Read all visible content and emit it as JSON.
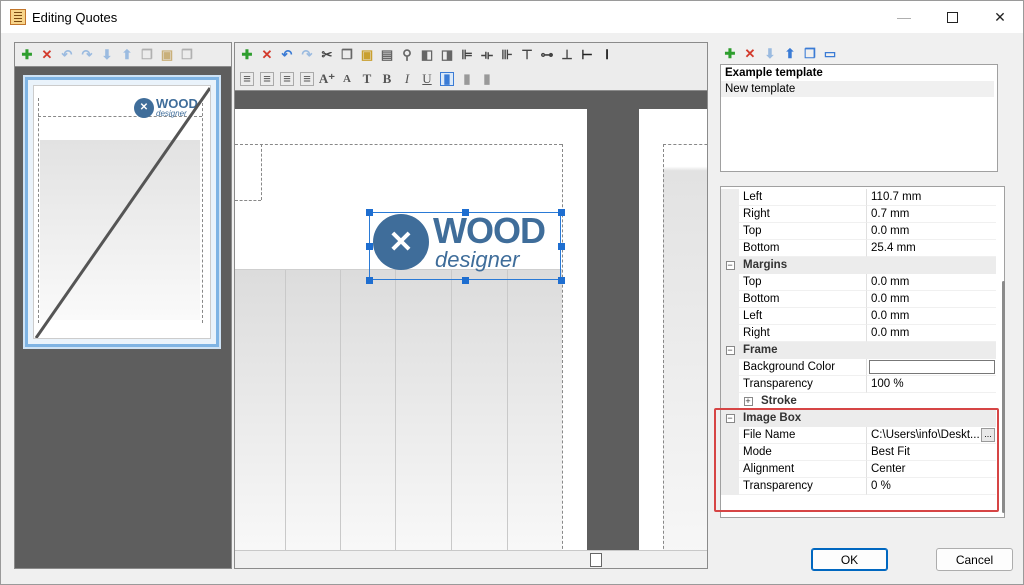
{
  "window": {
    "title": "Editing Quotes",
    "controls": {
      "minimize": "—",
      "close": "✕"
    }
  },
  "logo": {
    "word": "WOOD",
    "sub": "designer",
    "color": "#3f6d9a"
  },
  "templates": {
    "items": [
      {
        "label": "Example template",
        "selected": true
      },
      {
        "label": "New template",
        "selected": false
      }
    ]
  },
  "properties": {
    "rows": [
      {
        "type": "prop",
        "name": "Left",
        "value": "110.7 mm"
      },
      {
        "type": "prop",
        "name": "Right",
        "value": "0.7 mm"
      },
      {
        "type": "prop",
        "name": "Top",
        "value": "0.0 mm"
      },
      {
        "type": "prop",
        "name": "Bottom",
        "value": "25.4 mm"
      },
      {
        "type": "category",
        "name": "Margins",
        "toggle": "−"
      },
      {
        "type": "prop",
        "name": "Top",
        "value": "0.0 mm"
      },
      {
        "type": "prop",
        "name": "Bottom",
        "value": "0.0 mm"
      },
      {
        "type": "prop",
        "name": "Left",
        "value": "0.0 mm"
      },
      {
        "type": "prop",
        "name": "Right",
        "value": "0.0 mm"
      },
      {
        "type": "category",
        "name": "Frame",
        "toggle": "−"
      },
      {
        "type": "color",
        "name": "Background Color",
        "value": ""
      },
      {
        "type": "prop",
        "name": "Transparency",
        "value": "100 %"
      },
      {
        "type": "subcategory",
        "name": "Stroke",
        "toggle": "+"
      },
      {
        "type": "category",
        "name": "Image Box",
        "toggle": "−"
      },
      {
        "type": "file",
        "name": "File Name",
        "value": "C:\\Users\\info\\Deskt...",
        "button": "..."
      },
      {
        "type": "prop",
        "name": "Mode",
        "value": "Best Fit"
      },
      {
        "type": "prop",
        "name": "Alignment",
        "value": "Center"
      },
      {
        "type": "prop",
        "name": "Transparency",
        "value": "0 %"
      }
    ]
  },
  "buttons": {
    "ok": "OK",
    "cancel": "Cancel"
  },
  "colors": {
    "accent": "#0067c0",
    "highlight": "#d64545",
    "add": "#2e9e2e",
    "delete": "#d33a2c",
    "arrow": "#3a7bd5"
  }
}
